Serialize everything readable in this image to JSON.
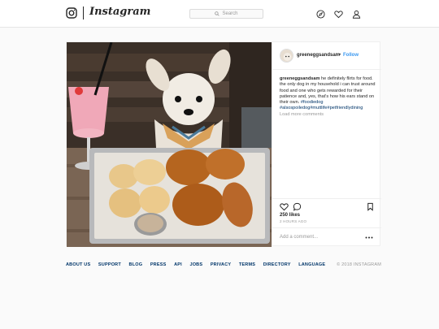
{
  "header": {
    "brand": "Instagram",
    "search_placeholder": "Search"
  },
  "post": {
    "username": "greeneggsandsam",
    "follow_separator": "•",
    "follow_label": "Follow",
    "caption_user": "greeneggsandsam",
    "caption_text": "he definitely flirts for food. the only dog in my household i can trust around food and one who gets rewarded for their patience and, yes, that's how his ears stand on their own.",
    "caption_tags": "#foodiedog #alsospoiledog#muttlife#petfriendlydining",
    "load_more": "Load more comments",
    "likes": "250 likes",
    "time": "2 HOURS AGO",
    "comment_placeholder": "Add a comment..."
  },
  "footer": {
    "links": [
      "ABOUT US",
      "SUPPORT",
      "BLOG",
      "PRESS",
      "API",
      "JOBS",
      "PRIVACY",
      "TERMS",
      "DIRECTORY",
      "LANGUAGE"
    ],
    "copyright": "© 2018 INSTAGRAM"
  },
  "icons": {
    "logo": "instagram-glyph-icon",
    "search": "search-icon",
    "explore": "compass-icon",
    "activity": "heart-icon",
    "profile": "person-icon",
    "like": "heart-outline-icon",
    "comment": "speech-bubble-icon",
    "save": "bookmark-icon",
    "more": "ellipsis-icon"
  },
  "colors": {
    "link": "#003569",
    "follow": "#3897f0",
    "muted": "#999999"
  }
}
